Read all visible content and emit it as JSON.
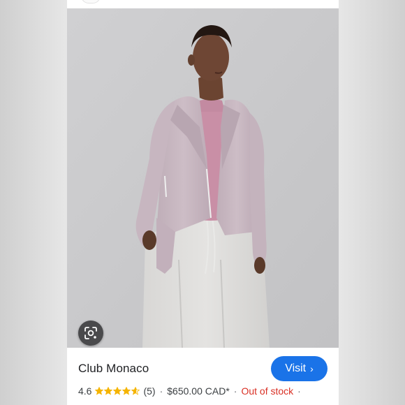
{
  "product": {
    "merchant": "Club Monaco",
    "visit_label": "Visit",
    "visit_chevron": "›",
    "rating": "4.6",
    "rating_value": 4.6,
    "rating_max": 5,
    "review_count": "(5)",
    "price": "$650.00 CAD*",
    "stock_status": "Out of stock",
    "separator": "·"
  },
  "icons": {
    "lens": "google-lens-icon",
    "star": "star-icon",
    "chevron": "chevron-right-icon"
  },
  "colors": {
    "visit_button": "#1a73e8",
    "out_of_stock": "#d93025",
    "star": "#f5b400",
    "jacket": "#c9b9c3",
    "top": "#c98fa6"
  }
}
